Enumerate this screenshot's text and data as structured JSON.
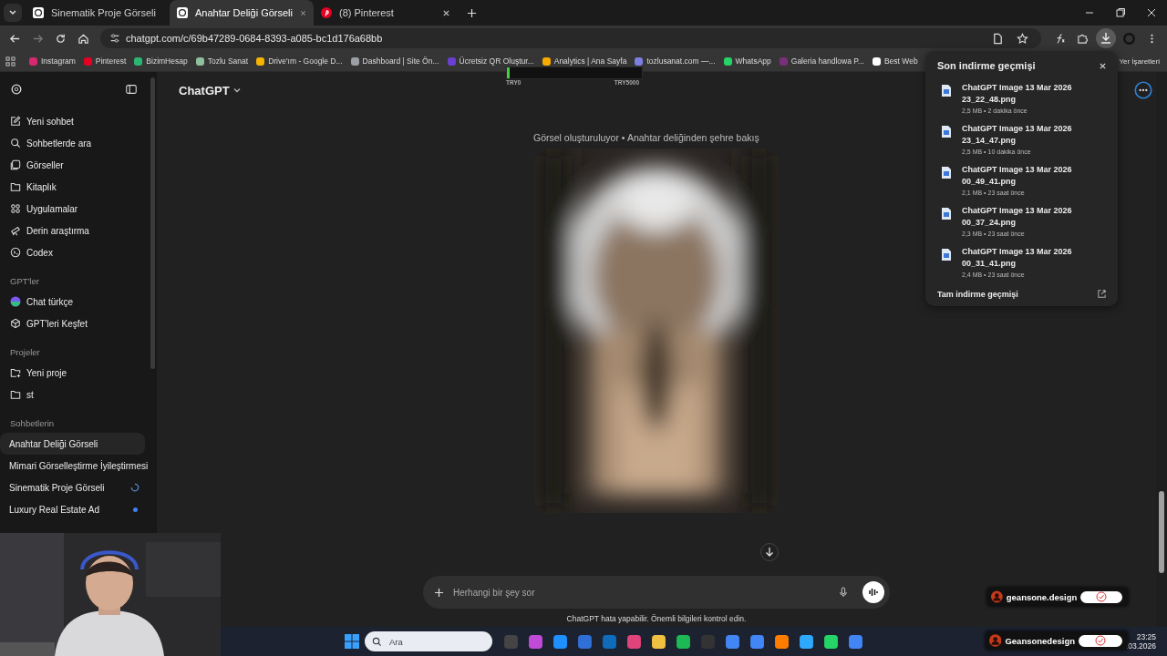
{
  "tabs": [
    {
      "title": "Sinematik Proje Görseli",
      "kind": "chatgpt",
      "selected": false
    },
    {
      "title": "Anahtar Deliği Görseli",
      "kind": "chatgpt",
      "selected": true
    },
    {
      "title": "(8) Pinterest",
      "kind": "pinterest",
      "selected": false
    }
  ],
  "address": "chatgpt.com/c/69b47289-0684-8393-a085-bc1d176a68bb",
  "bookmarks": [
    {
      "label": "Instagram",
      "color": "#d6296f"
    },
    {
      "label": "Pinterest",
      "color": "#e60023"
    },
    {
      "label": "BizimHesap",
      "color": "#2bb673"
    },
    {
      "label": "Tozlu Sanat",
      "color": "#8fbf9f"
    },
    {
      "label": "Drive'ım - Google D...",
      "color": "#f4b400"
    },
    {
      "label": "Dashboard | Site Ön...",
      "color": "#9aa0a6"
    },
    {
      "label": "Ücretsiz QR Oluştur...",
      "color": "#6a3fd1"
    },
    {
      "label": "Analytics | Ana Sayfa",
      "color": "#f9ab00"
    },
    {
      "label": "tozlusanat.com —...",
      "color": "#7b7fe0"
    },
    {
      "label": "WhatsApp",
      "color": "#25d366"
    },
    {
      "label": "Galeria handlowa P...",
      "color": "#7a2f7a"
    },
    {
      "label": "Best Web",
      "color": "#ffffff"
    }
  ],
  "bookmarks_all": "Yer İşaretleri",
  "sidebar": {
    "items": [
      {
        "label": "Yeni sohbet",
        "kind": "edit"
      },
      {
        "label": "Sohbetlerde ara",
        "kind": "search"
      },
      {
        "label": "Görseller",
        "kind": "images"
      },
      {
        "label": "Kitaplık",
        "kind": "folder"
      },
      {
        "label": "Uygulamalar",
        "kind": "apps"
      },
      {
        "label": "Derin araştırma",
        "kind": "telescope"
      },
      {
        "label": "Codex",
        "kind": "codex"
      }
    ],
    "gpts_heading": "GPT'ler",
    "gpts": [
      {
        "label": "Chat türkçe",
        "kind": "gpt"
      },
      {
        "label": "GPT'leri Keşfet",
        "kind": "explore"
      }
    ],
    "projects_heading": "Projeler",
    "projects": [
      {
        "label": "Yeni proje",
        "kind": "newfolder"
      },
      {
        "label": "st",
        "kind": "folder"
      }
    ],
    "chats_heading": "Sohbetlerin",
    "chats": [
      {
        "label": "Anahtar Deliği Görseli",
        "selected": true
      },
      {
        "label": "Mimari Görselleştirme İyileştirmesi",
        "selected": false
      },
      {
        "label": "Sinematik Proje Görseli",
        "selected": false,
        "kind": "loading"
      },
      {
        "label": "Luxury Real Estate Ad",
        "selected": false,
        "kind": "unread"
      }
    ]
  },
  "header": {
    "title": "ChatGPT"
  },
  "overlay_meter": {
    "level": 0.02,
    "min_label": "TRY0",
    "max_label": "TRY5000"
  },
  "caption": "Görsel oluşturuluyor • Anahtar deliğinden şehre bakış",
  "composer": {
    "placeholder": "Herhangi bir şey sor"
  },
  "disclaimer": "ChatGPT hata yapabilir. Önemli bilgileri kontrol edin.",
  "downloads": {
    "title": "Son indirme geçmişi",
    "items": [
      {
        "name": "ChatGPT Image 13 Mar 2026 23_22_48.png",
        "meta": "2,5 MB • 2 dakika önce"
      },
      {
        "name": "ChatGPT Image 13 Mar 2026 23_14_47.png",
        "meta": "2,5 MB • 10 dakika önce"
      },
      {
        "name": "ChatGPT Image 13 Mar 2026 00_49_41.png",
        "meta": "2,1 MB • 23 saat önce"
      },
      {
        "name": "ChatGPT Image 13 Mar 2026 00_37_24.png",
        "meta": "2,3 MB • 23 saat önce"
      },
      {
        "name": "ChatGPT Image 13 Mar 2026 00_31_41.png",
        "meta": "2,4 MB • 23 saat önce"
      }
    ],
    "footer": "Tam indirme geçmişi"
  },
  "stream_badges": [
    "geansone.design",
    "Geansonedesign"
  ],
  "taskbar": {
    "search_placeholder": "Ara",
    "time": "23:25",
    "date": ".03.2026"
  }
}
